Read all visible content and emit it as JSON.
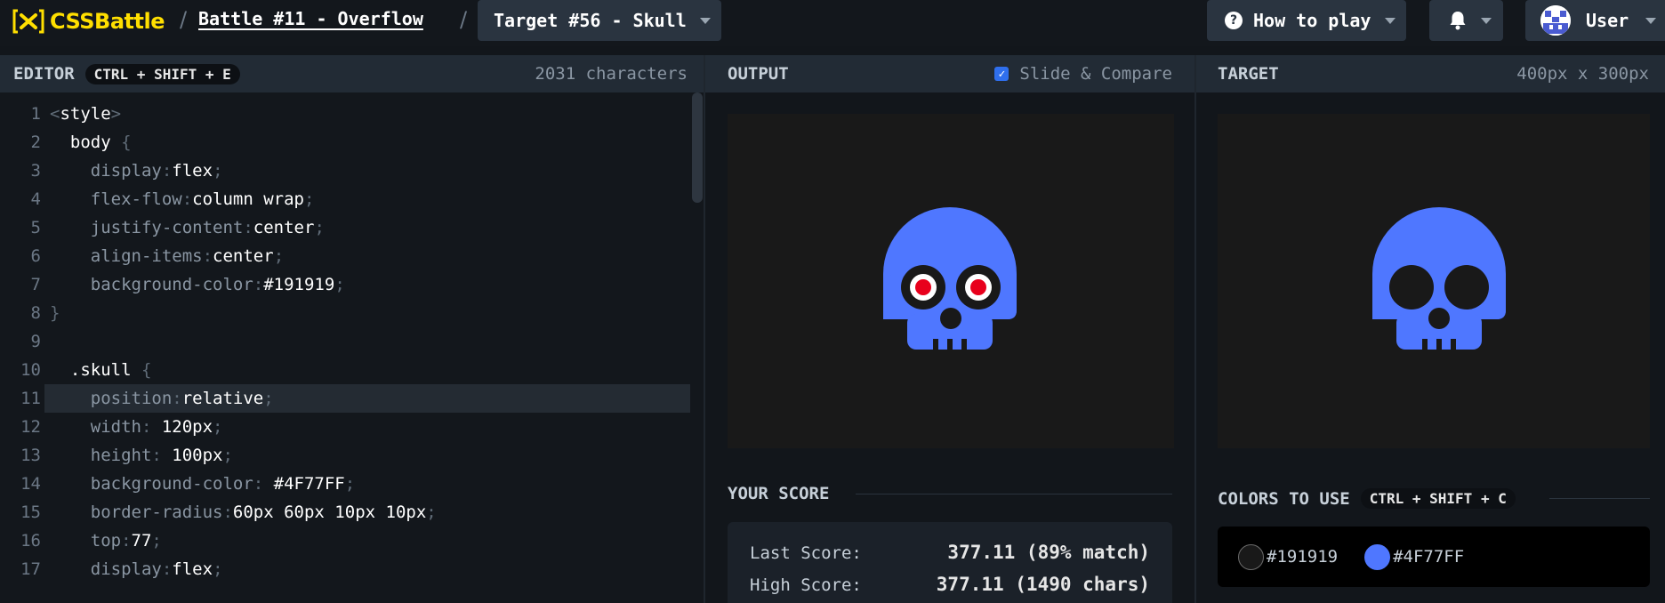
{
  "header": {
    "logo_text": "CSSBattle",
    "battle_link": "Battle #11 - Overflow",
    "target_select": "Target #56 - Skull",
    "how_to_play": "How to play",
    "user_name": "User"
  },
  "editor": {
    "title": "EDITOR",
    "shortcut": "CTRL + SHIFT + E",
    "char_count": "2031 characters",
    "lines": [
      {
        "n": "1",
        "parts": [
          [
            "punct",
            "<"
          ],
          [
            "val",
            "style"
          ],
          [
            "punct",
            ">"
          ]
        ]
      },
      {
        "n": "2",
        "parts": [
          [
            "val",
            "  body "
          ],
          [
            "punct",
            "{"
          ]
        ]
      },
      {
        "n": "3",
        "parts": [
          [
            "prop",
            "    display"
          ],
          [
            "punct",
            ":"
          ],
          [
            "val",
            "flex"
          ],
          [
            "punct",
            ";"
          ]
        ]
      },
      {
        "n": "4",
        "parts": [
          [
            "prop",
            "    flex-flow"
          ],
          [
            "punct",
            ":"
          ],
          [
            "val",
            "column wrap"
          ],
          [
            "punct",
            ";"
          ]
        ]
      },
      {
        "n": "5",
        "parts": [
          [
            "prop",
            "    justify-content"
          ],
          [
            "punct",
            ":"
          ],
          [
            "val",
            "center"
          ],
          [
            "punct",
            ";"
          ]
        ]
      },
      {
        "n": "6",
        "parts": [
          [
            "prop",
            "    align-items"
          ],
          [
            "punct",
            ":"
          ],
          [
            "val",
            "center"
          ],
          [
            "punct",
            ";"
          ]
        ]
      },
      {
        "n": "7",
        "parts": [
          [
            "prop",
            "    background-color"
          ],
          [
            "punct",
            ":"
          ],
          [
            "val",
            "#191919"
          ],
          [
            "punct",
            ";"
          ]
        ]
      },
      {
        "n": "8",
        "parts": [
          [
            "punct",
            "}"
          ]
        ]
      },
      {
        "n": "9",
        "parts": []
      },
      {
        "n": "10",
        "parts": [
          [
            "val",
            "  .skull "
          ],
          [
            "punct",
            "{"
          ]
        ]
      },
      {
        "n": "11",
        "parts": [
          [
            "prop",
            "    position"
          ],
          [
            "punct",
            ":"
          ],
          [
            "val",
            "relative"
          ],
          [
            "punct",
            ";"
          ]
        ],
        "active": true
      },
      {
        "n": "12",
        "parts": [
          [
            "prop",
            "    width"
          ],
          [
            "punct",
            ": "
          ],
          [
            "val",
            "120px"
          ],
          [
            "punct",
            ";"
          ]
        ]
      },
      {
        "n": "13",
        "parts": [
          [
            "prop",
            "    height"
          ],
          [
            "punct",
            ": "
          ],
          [
            "val",
            "100px"
          ],
          [
            "punct",
            ";"
          ]
        ]
      },
      {
        "n": "14",
        "parts": [
          [
            "prop",
            "    background-color"
          ],
          [
            "punct",
            ": "
          ],
          [
            "val",
            "#4F77FF"
          ],
          [
            "punct",
            ";"
          ]
        ]
      },
      {
        "n": "15",
        "parts": [
          [
            "prop",
            "    border-radius"
          ],
          [
            "punct",
            ":"
          ],
          [
            "val",
            "60px 60px 10px 10px"
          ],
          [
            "punct",
            ";"
          ]
        ]
      },
      {
        "n": "16",
        "parts": [
          [
            "prop",
            "    top"
          ],
          [
            "punct",
            ":"
          ],
          [
            "val",
            "77"
          ],
          [
            "punct",
            ";"
          ]
        ]
      },
      {
        "n": "17",
        "parts": [
          [
            "prop",
            "    display"
          ],
          [
            "punct",
            ":"
          ],
          [
            "val",
            "flex"
          ],
          [
            "punct",
            ";"
          ]
        ]
      }
    ]
  },
  "output": {
    "title": "OUTPUT",
    "slide_compare": "Slide & Compare",
    "slide_compare_checked": true
  },
  "target": {
    "title": "TARGET",
    "size": "400px x 300px"
  },
  "score": {
    "title": "YOUR SCORE",
    "last_label": "Last Score:",
    "last_value": "377.11 (89% match)",
    "high_label": "High Score:",
    "high_value": "377.11 (1490 chars)"
  },
  "colors": {
    "title": "COLORS TO USE",
    "shortcut": "CTRL + SHIFT + C",
    "items": [
      {
        "hex": "#191919",
        "label": "#191919"
      },
      {
        "hex": "#4F77FF",
        "label": "#4F77FF"
      }
    ]
  },
  "theme": {
    "accent_yellow": "#ffdf00",
    "skull_blue": "#4F77FF",
    "canvas_bg": "#191919",
    "eye_red": "#e8001c"
  }
}
